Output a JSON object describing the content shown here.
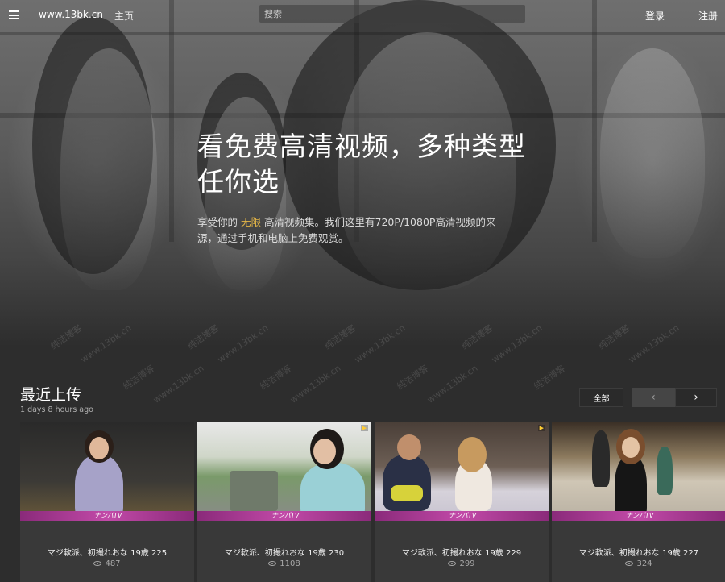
{
  "nav": {
    "site_name": "www.13bk.cn",
    "home": "主页",
    "search_placeholder": "搜索",
    "login": "登录",
    "register": "注册"
  },
  "hero": {
    "headline": "看免费高清视频，多种类型任你选",
    "sub_before": "享受你的",
    "sub_highlight": "无限",
    "sub_after": "高清视频集。我们这里有720P/1080P高清视频的来源，通过手机和电脑上免费观赏。",
    "highlight_color": "#e3b547"
  },
  "watermark": {
    "text_cn": "纯洁博客",
    "text_url": "www.13bk.cn"
  },
  "section": {
    "title": "最近上传",
    "time": "1 days 8 hours ago",
    "all_button": "全部",
    "prev_icon": "chevron-left-icon",
    "next_icon": "chevron-right-icon"
  },
  "videos": [
    {
      "title": "マジ軟派、初撮れおな 19歳 225",
      "views": "487",
      "band": "ナンパTV"
    },
    {
      "title": "マジ軟派、初撮れおな 19歳 230",
      "views": "1108",
      "band": "ナンパTV"
    },
    {
      "title": "マジ軟派、初撮れおな 19歳 229",
      "views": "299",
      "band": "ナンパTV"
    },
    {
      "title": "マジ軟派、初撮れおな 19歳 227",
      "views": "324",
      "band": "ナンパTV"
    }
  ],
  "colors": {
    "background": "#2d2d2d",
    "card": "#393939",
    "band": "#c24aa8"
  }
}
